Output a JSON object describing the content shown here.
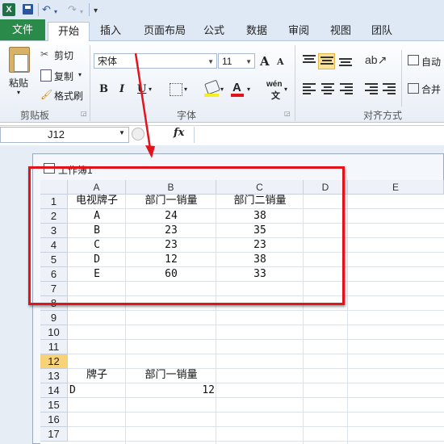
{
  "qat": {
    "logo": "X",
    "undo": "↶",
    "redo": "↷",
    "customize": "▾"
  },
  "tabs": [
    "文件",
    "开始",
    "插入",
    "页面布局",
    "公式",
    "数据",
    "审阅",
    "视图",
    "团队"
  ],
  "ribbon": {
    "paste": "粘贴",
    "cut": "剪切",
    "copy": "复制",
    "format_painter": "格式刷",
    "font_name": "宋体",
    "font_size": "11",
    "grow_font": "A",
    "shrink_font": "A",
    "bold": "B",
    "italic": "I",
    "underline": "U",
    "font_color": "A",
    "phonetic": "wén",
    "wrap_text": "自动",
    "merge": "合并",
    "groups": {
      "clipboard": "剪贴板",
      "font": "字体",
      "alignment": "对齐方式"
    },
    "accent": "#2a8a4a"
  },
  "formula_bar": {
    "name_box": "J12",
    "fx": "fx",
    "formula": ""
  },
  "workbook": {
    "title": "工作簿1"
  },
  "grid": {
    "columns": [
      "A",
      "B",
      "C",
      "D",
      "E"
    ],
    "rows": [
      "1",
      "2",
      "3",
      "4",
      "5",
      "6",
      "7",
      "8",
      "9",
      "10",
      "11",
      "12",
      "13",
      "14",
      "15",
      "16",
      "17"
    ],
    "selected_row": "12",
    "cells": {
      "A1": "电视牌子",
      "B1": "部门一销量",
      "C1": "部门二销量",
      "A2": "A",
      "B2": "24",
      "C2": "38",
      "A3": "B",
      "B3": "23",
      "C3": "35",
      "A4": "C",
      "B4": "23",
      "C4": "23",
      "A5": "D",
      "B5": "12",
      "C5": "38",
      "A6": "E",
      "B6": "60",
      "C6": "33",
      "A13": "牌子",
      "B13": "部门一销量",
      "A14": "D",
      "B14": "12"
    }
  },
  "annotation_color": "#e2141b"
}
